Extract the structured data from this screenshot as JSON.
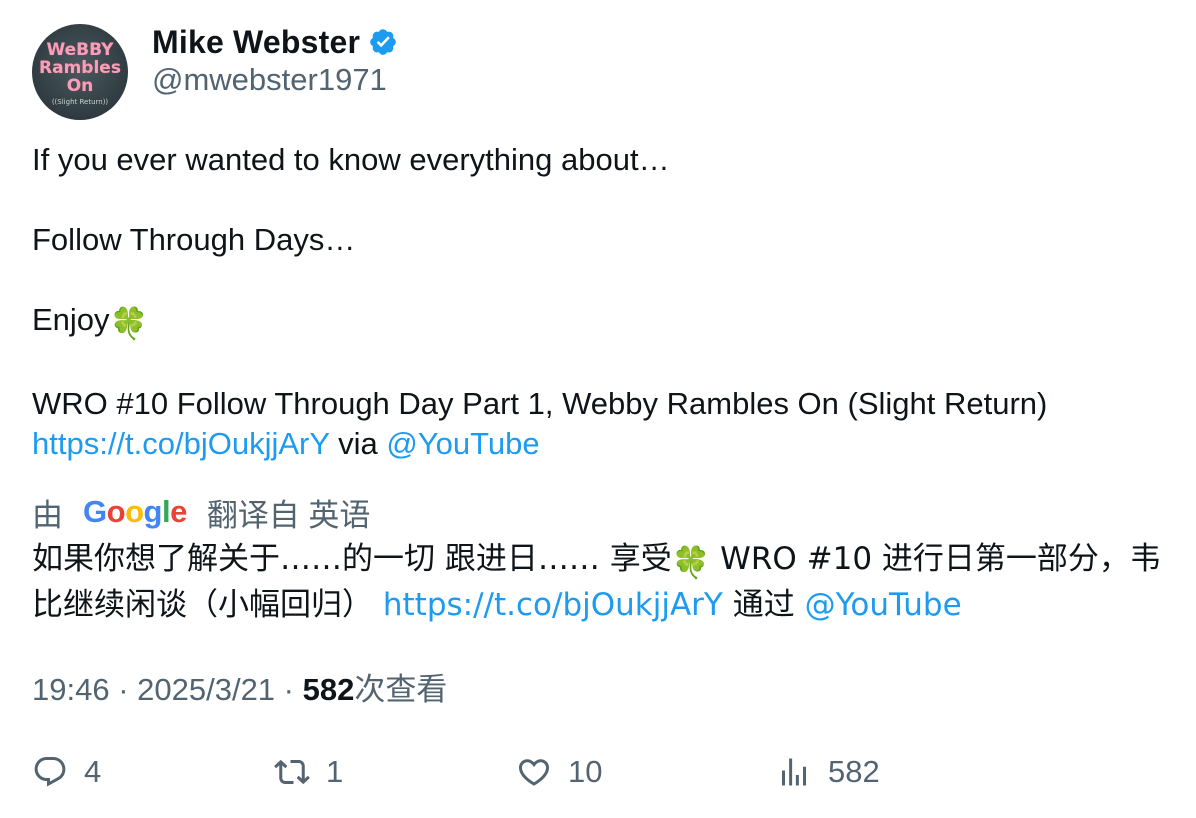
{
  "author": {
    "display_name": "Mike Webster",
    "handle": "@mwebster1971",
    "avatar_text": [
      "WeBBY",
      "Rambles",
      "On",
      "((Slight Return))"
    ],
    "verified_icon": "verified-badge-icon"
  },
  "tweet": {
    "line1": "If you ever wanted to know everything about…",
    "line2": "Follow Through Days…",
    "line3": "Enjoy",
    "line3_emoji": "🍀",
    "line4": "WRO #10 Follow Through Day Part 1, Webby Rambles On (Slight Return)",
    "link_text": "https://t.co/bjOukjjArY",
    "via_text": " via ",
    "mention": "@YouTube"
  },
  "translation": {
    "prefix": "由",
    "provider": "Google",
    "suffix": "翻译自 英语",
    "text_part1": "如果你想了解关于……的一切 跟进日…… 享受",
    "emoji": "🍀",
    "text_part2": " WRO #10 进行日第一部分，韦比继续闲谈（小幅回归） ",
    "link_text": "https://t.co/bjOukjjArY",
    "via_text": " 通过 ",
    "mention": "@YouTube"
  },
  "meta": {
    "time": "19:46",
    "separator": " · ",
    "date": "2025/3/21",
    "views_count": "582",
    "views_label": "次查看"
  },
  "actions": {
    "replies": "4",
    "retweets": "1",
    "likes": "10",
    "views": "582",
    "icons": [
      "reply-icon",
      "retweet-icon",
      "like-icon",
      "views-icon"
    ]
  },
  "colors": {
    "text": "#0f1419",
    "secondary": "#536471",
    "link": "#1d9bf0",
    "verified": "#1d9bf0"
  }
}
